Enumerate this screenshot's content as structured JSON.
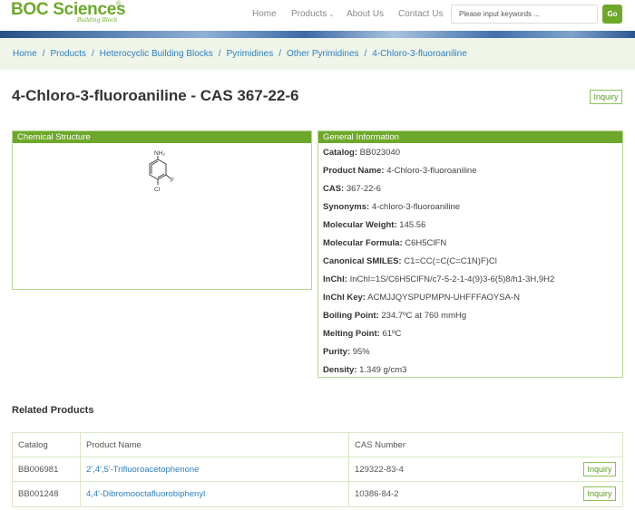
{
  "header": {
    "logo_text": "BOC Sciences",
    "logo_reg": "®",
    "logo_sub": "Building Block",
    "nav": [
      {
        "label": "Home"
      },
      {
        "label": "Products"
      },
      {
        "label": "About Us"
      },
      {
        "label": "Contact Us"
      }
    ],
    "search_placeholder": "Please input keywords ...",
    "go_label": "Go"
  },
  "breadcrumb": [
    "Home",
    "Products",
    "Heterocyclic Building Blocks",
    "Pyrimidines",
    "Other Pyrimidines",
    "4-Chloro-3-fluoroaniline"
  ],
  "title": "4-Chloro-3-fluoroaniline - CAS 367-22-6",
  "inquiry_label": "Inquiry",
  "structure": {
    "heading": "Chemical Structure",
    "atoms": {
      "top": "NH₂",
      "right": "F",
      "bottom": "Cl"
    }
  },
  "general": {
    "heading": "General Information",
    "rows": [
      {
        "label": "Catalog:",
        "value": "BB023040"
      },
      {
        "label": "Product Name:",
        "value": "4-Chloro-3-fluoroaniline"
      },
      {
        "label": "CAS:",
        "value": "367-22-6"
      },
      {
        "label": "Synonyms:",
        "value": "4-chloro-3-fluoroaniline"
      },
      {
        "label": "Molecular Weight:",
        "value": "145.56"
      },
      {
        "label": "Molecular Formula:",
        "value": "C6H5ClFN"
      },
      {
        "label": "Canonical SMILES:",
        "value": "C1=CC(=C(C=C1N)F)Cl"
      },
      {
        "label": "InChI:",
        "value": "InChI=1S/C6H5ClFN/c7-5-2-1-4(9)3-6(5)8/h1-3H,9H2"
      },
      {
        "label": "InChI Key:",
        "value": "ACMJJQYSPUPMPN-UHFFFAOYSA-N"
      },
      {
        "label": "Boiling Point:",
        "value": "234.7ºC at 760 mmHg"
      },
      {
        "label": "Melting Point:",
        "value": "61ºC"
      },
      {
        "label": "Purity:",
        "value": "95%"
      },
      {
        "label": "Density:",
        "value": "1.349 g/cm3"
      }
    ]
  },
  "related": {
    "heading": "Related Products",
    "columns": [
      "Catalog",
      "Product Name",
      "CAS Number"
    ],
    "rows": [
      {
        "catalog": "BB006981",
        "name": "2',4',5'-Trifluoroacetophenone",
        "cas": "129322-83-4",
        "action": "Inquiry"
      },
      {
        "catalog": "BB001248",
        "name": "4,4'-Dibromooctafluorobiphenyl",
        "cas": "10386-84-2",
        "action": "Inquiry"
      }
    ]
  },
  "colors": {
    "brand_green": "#6da82b",
    "link_blue": "#2d7fc1",
    "crumb_bg": "#f0f5e9"
  }
}
